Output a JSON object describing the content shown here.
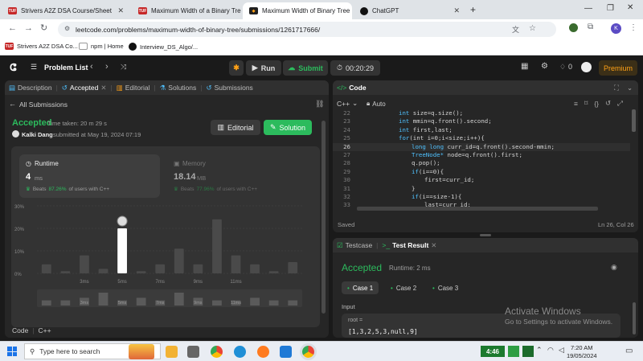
{
  "browser": {
    "tabs": [
      {
        "title": "Strivers A2Z DSA Course/Sheet",
        "active": false
      },
      {
        "title": "Maximum Width of a Binary Tre",
        "active": false
      },
      {
        "title": "Maximum Width of Binary Tree",
        "active": true
      },
      {
        "title": "ChatGPT",
        "active": false
      }
    ],
    "new_tab": "+",
    "url": "leetcode.com/problems/maximum-width-of-binary-tree/submissions/1261717666/",
    "bookmarks": [
      "Strivers A2Z DSA Co...",
      "npm | Home",
      "Interview_DS_Algo/..."
    ],
    "profile_initial": "K"
  },
  "header": {
    "problem_list": "Problem List",
    "run": "Run",
    "submit": "Submit",
    "timer": "00:20:29",
    "streak": "0",
    "premium": "Premium"
  },
  "left": {
    "tabs": [
      "Description",
      "Accepted",
      "Editorial",
      "Solutions",
      "Submissions"
    ],
    "all_submissions": "All Submissions",
    "status": "Accepted",
    "time_taken": "Time taken: 20 m 29 s",
    "user": "Kalki Dang",
    "submitted_at": "submitted at May 19, 2024 07:19",
    "editorial_btn": "Editorial",
    "solution_btn": "Solution",
    "runtime": {
      "label": "Runtime",
      "value": "4",
      "unit": "ms",
      "beats_prefix": "Beats",
      "beats": "87.26%",
      "beats_suffix": "of users with C++"
    },
    "memory": {
      "label": "Memory",
      "value": "18.14",
      "unit": "MB",
      "beats_prefix": "Beats",
      "beats": "77.96%",
      "beats_suffix": "of users with C++"
    },
    "footer_code": "Code",
    "footer_lang": "C++"
  },
  "chart_data": {
    "type": "bar",
    "yticks": [
      "30%",
      "20%",
      "10%",
      "0%"
    ],
    "ylim": [
      0,
      30
    ],
    "xticks": [
      "3ms",
      "5ms",
      "7ms",
      "9ms",
      "11ms"
    ],
    "values": [
      4,
      1,
      8,
      2,
      20,
      1,
      4,
      11,
      4,
      24,
      8,
      4,
      1,
      5
    ],
    "highlight_index": 4,
    "mini_values": [
      2,
      2,
      3,
      5,
      2,
      3,
      2,
      5,
      3,
      2,
      2,
      3,
      2,
      2
    ],
    "bar_color": "#4a4a4a",
    "highlight_color": "#ffffff"
  },
  "code": {
    "title": "Code",
    "lang": "C++",
    "mode": "Auto",
    "lines": [
      {
        "n": "22",
        "indent": 0,
        "text": "int size=q.size();"
      },
      {
        "n": "23",
        "indent": 0,
        "text": "int mmin=q.front().second;"
      },
      {
        "n": "24",
        "indent": 0,
        "text": "int first,last;"
      },
      {
        "n": "25",
        "indent": 0,
        "text": "for(int i=0;i<size;i++){"
      },
      {
        "n": "26",
        "indent": 1,
        "text": "long long curr_id=q.front().second-mmin;"
      },
      {
        "n": "27",
        "indent": 1,
        "text": "TreeNode* node=q.front().first;"
      },
      {
        "n": "28",
        "indent": 1,
        "text": "q.pop();"
      },
      {
        "n": "29",
        "indent": 1,
        "text": "if(i==0){"
      },
      {
        "n": "30",
        "indent": 2,
        "text": "first=curr_id;"
      },
      {
        "n": "31",
        "indent": 1,
        "text": "}"
      },
      {
        "n": "32",
        "indent": 1,
        "text": "if(i==size-1){"
      },
      {
        "n": "33",
        "indent": 2,
        "text": "last=curr_id;"
      }
    ],
    "saved": "Saved",
    "cursor": "Ln 26, Col 26"
  },
  "test": {
    "tabs": [
      "Testcase",
      "Test Result"
    ],
    "status": "Accepted",
    "runtime": "Runtime: 2 ms",
    "cases": [
      "Case 1",
      "Case 2",
      "Case 3"
    ],
    "input_label": "Input",
    "var": "root =",
    "value": "[1,3,2,5,3,null,9]"
  },
  "watermark": {
    "line1": "Activate Windows",
    "line2": "Go to Settings to activate Windows."
  },
  "taskbar": {
    "search": "Type here to search",
    "clock_time": "7:20 AM",
    "clock_date": "19/05/2024",
    "badge": "4:46"
  },
  "colors": {
    "accent_green": "#2cbb5d",
    "accent_orange": "#ffa116",
    "bg": "#1a1a1a"
  }
}
